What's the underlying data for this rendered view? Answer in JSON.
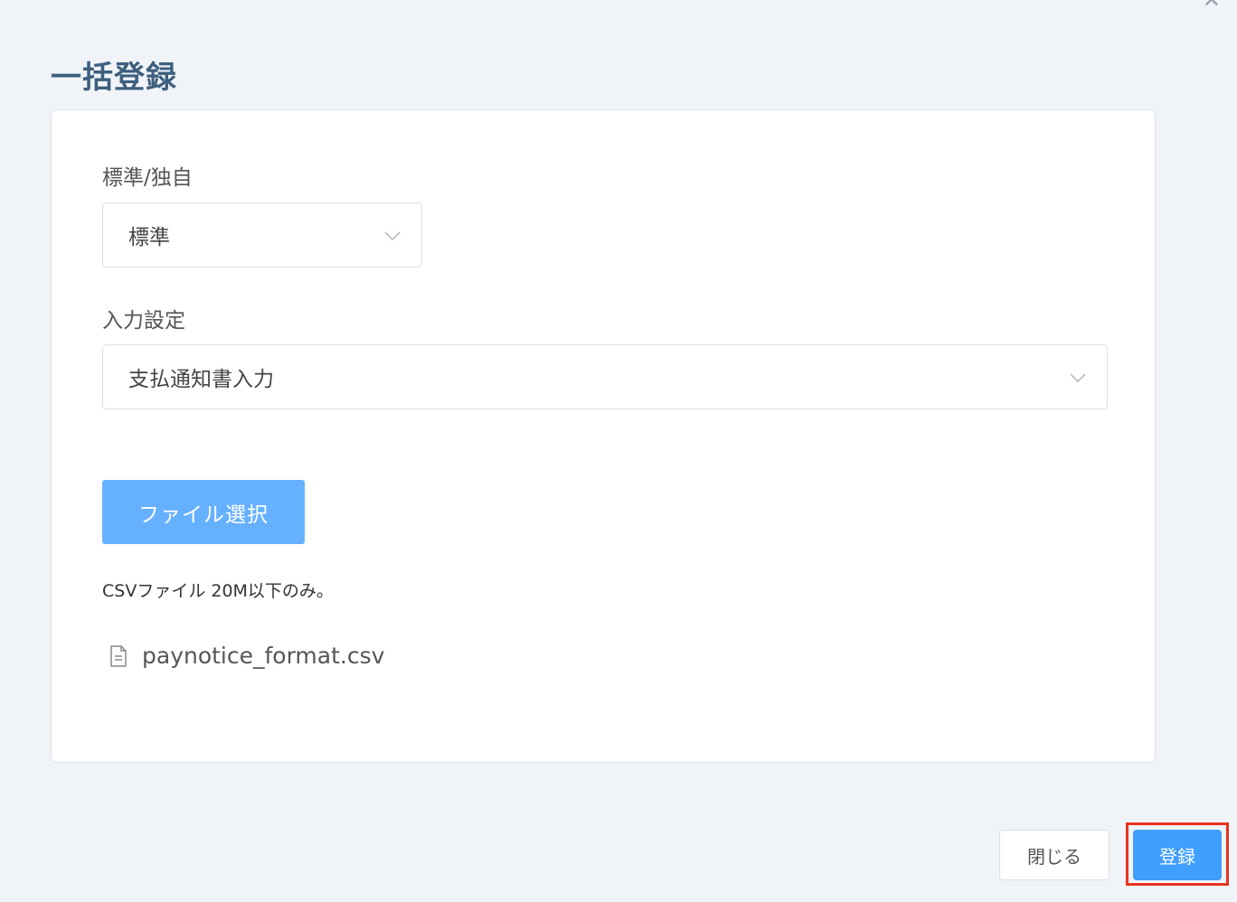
{
  "dialog": {
    "title": "一括登録",
    "close_icon": "close-icon"
  },
  "form": {
    "type_field": {
      "label": "標準/独自",
      "value": "標準"
    },
    "input_setting_field": {
      "label": "入力設定",
      "value": "支払通知書入力"
    },
    "file_select_label": "ファイル選択",
    "hint": "CSVファイル 20M以下のみ。",
    "file": {
      "icon": "document-icon",
      "name": "paynotice_format.csv"
    }
  },
  "footer": {
    "close_label": "閉じる",
    "submit_label": "登録"
  },
  "colors": {
    "primary": "#409eff",
    "primary_light": "#66b1ff",
    "title": "#3e5f7e",
    "highlight": "#e8331f"
  }
}
